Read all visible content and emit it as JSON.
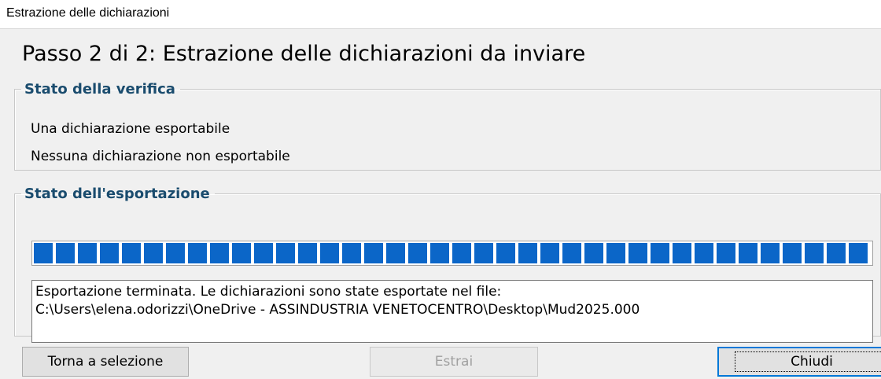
{
  "window": {
    "title": "Estrazione delle dichiarazioni"
  },
  "heading": "Passo 2 di 2: Estrazione delle dichiarazioni da inviare",
  "verification": {
    "title": "Stato della verifica",
    "exportable": "Una dichiarazione esportabile",
    "not_exportable": "Nessuna dichiarazione non esportabile"
  },
  "export": {
    "title": "Stato dell'esportazione",
    "progress_percent": 100,
    "log_lines": [
      "Esportazione terminata. Le dichiarazioni sono state esportate nel file:",
      "C:\\Users\\elena.odorizzi\\OneDrive - ASSINDUSTRIA VENETOCENTRO\\Desktop\\Mud2025.000"
    ]
  },
  "buttons": {
    "back": "Torna a selezione",
    "extract": "Estrai",
    "close": "Chiudi"
  },
  "colors": {
    "progress": "#0b66c8",
    "group_title": "#1a4c6e"
  }
}
